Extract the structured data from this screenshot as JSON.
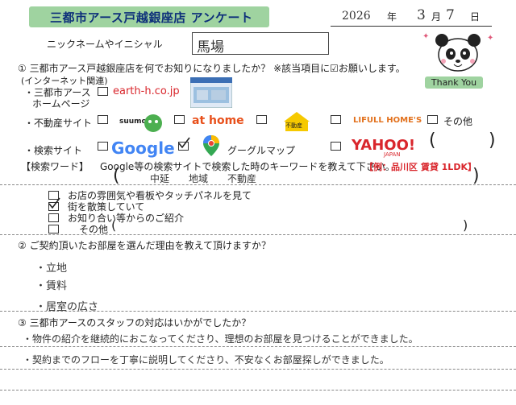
{
  "header": {
    "title": "三都市アース戸越銀座店 アンケート",
    "date_year": "2026",
    "year_label": "年",
    "date_month": "3",
    "month_label": "月",
    "date_day": "7",
    "day_label": "日"
  },
  "nickname": {
    "label": "ニックネームやイニシャル",
    "value": "馬場"
  },
  "q1": {
    "question": "① 三都市アース戸越銀座店を何でお知りになりましたか？ ※該当項目に☑お願いします。",
    "internet_note": "(インターネット関連)",
    "homepage_label_1": "・三都市アース",
    "homepage_label_2": "ホームページ",
    "homepage_url": "earth-h.co.jp",
    "realestate_label": "・不動産サイト",
    "suumo": "suumo",
    "athome": "at home",
    "yahoo_fudosan": "不動産",
    "lifull": "LIFULL HOME'S",
    "other": "その他",
    "search_label": "・検索サイト",
    "google": "Google",
    "google_maps": "グーグルマップ",
    "yahoo": "YAHOO!",
    "yahoo_japan": "JAPAN",
    "paren_open": "(",
    "paren_close": ")",
    "keyword_label": "【検索ワード】",
    "keyword_instruction": "Google等の検索サイトで検索した時のキーワードを教えて下さい。",
    "keyword_example": "【例：品川区 賃貸 1LDK】",
    "keyword_answer": "中延　　地域　　不動産",
    "option_1": "お店の雰囲気や看板やタッチパネルを見て",
    "option_2": "街を散策していて",
    "option_3": "お知り合い等からのご紹介",
    "option_4": "その他"
  },
  "q2": {
    "question": "② ご契約頂いたお部屋を選んだ理由を教えて頂けますか？",
    "answers": [
      "・立地",
      "・賃料",
      "・居室の広さ"
    ]
  },
  "q3": {
    "question": "③ 三都市アースのスタッフの対応はいかがでしたか？",
    "answers": [
      "・物件の紹介を継続的におこなってくださり、理想のお部屋を見つけることができました。",
      "・契約までのフローを丁寧に説明してくださり、不安なくお部屋探しができました。"
    ]
  },
  "mascot": {
    "thank_you": "Thank You"
  },
  "colors": {
    "title_bg": "#9fd3a0",
    "title_text": "#0d2f7a",
    "example_red": "#d9262c"
  }
}
